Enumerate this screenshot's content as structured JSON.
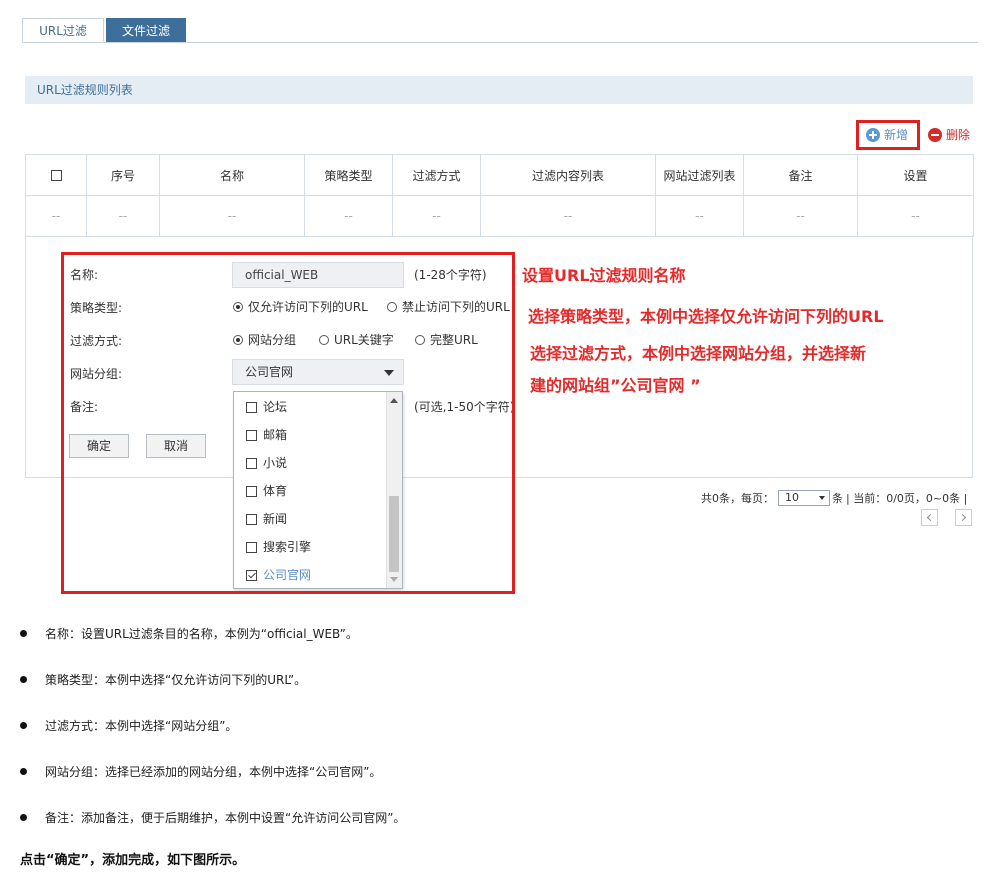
{
  "tabs": [
    {
      "label": "URL过滤",
      "active": true
    },
    {
      "label": "文件过滤",
      "active": false
    }
  ],
  "section_title": "URL过滤规则列表",
  "actions": {
    "add_label": "新增",
    "delete_label": "删除"
  },
  "table": {
    "headers": [
      "序号",
      "名称",
      "策略类型",
      "过滤方式",
      "过滤内容列表",
      "网站过滤列表",
      "备注",
      "设置"
    ],
    "empty_row": [
      "--",
      "--",
      "--",
      "--",
      "--",
      "--",
      "--",
      "--",
      "--"
    ]
  },
  "form": {
    "name_label": "名称:",
    "name_value": "official_WEB",
    "name_hint": "(1-28个字符)",
    "policy_label": "策略类型:",
    "policy_options": [
      "仅允许访问下列的URL",
      "禁止访问下列的URL"
    ],
    "policy_selected": "仅允许访问下列的URL",
    "filter_label": "过滤方式:",
    "filter_options": [
      "网站分组",
      "URL关键字",
      "完整URL"
    ],
    "filter_selected": "网站分组",
    "group_label": "网站分组:",
    "group_value": "公司官网",
    "note_label": "备注:",
    "note_hint": "(可选,1-50个字符)",
    "ok_label": "确定",
    "cancel_label": "取消",
    "dropdown_items": [
      {
        "label": "论坛",
        "checked": false
      },
      {
        "label": "邮箱",
        "checked": false
      },
      {
        "label": "小说",
        "checked": false
      },
      {
        "label": "体育",
        "checked": false
      },
      {
        "label": "新闻",
        "checked": false
      },
      {
        "label": "搜索引擎",
        "checked": false
      },
      {
        "label": "公司官网",
        "checked": true
      }
    ]
  },
  "annotations": [
    "设置URL过滤规则名称",
    "选择策略类型，本例中选择仅允许访问下列的URL",
    "选择过滤方式，本例中选择网站分组，并选择新",
    "建的网站组”公司官网 ”"
  ],
  "pagination": {
    "total_text": "共0条，每页：",
    "per_page": "10",
    "unit": "条",
    "current_text": "| 当前：0/0页，0~0条 |"
  },
  "bullets": [
    "名称：设置URL过滤条目的名称，本例为“official_WEB”。",
    "策略类型：本例中选择“仅允许访问下列的URL”。",
    "过滤方式：本例中选择“网站分组”。",
    "网站分组：选择已经添加的网站分组，本例中选择“公司官网”。",
    "备注：添加备注，便于后期维护，本例中设置“允许访问公司官网”。"
  ],
  "conclusion": "点击“确定”，添加完成，如下图所示。",
  "colors": {
    "accent": "#3e6f9a",
    "highlight_red": "#e02020",
    "link_blue": "#5b8fc7"
  }
}
